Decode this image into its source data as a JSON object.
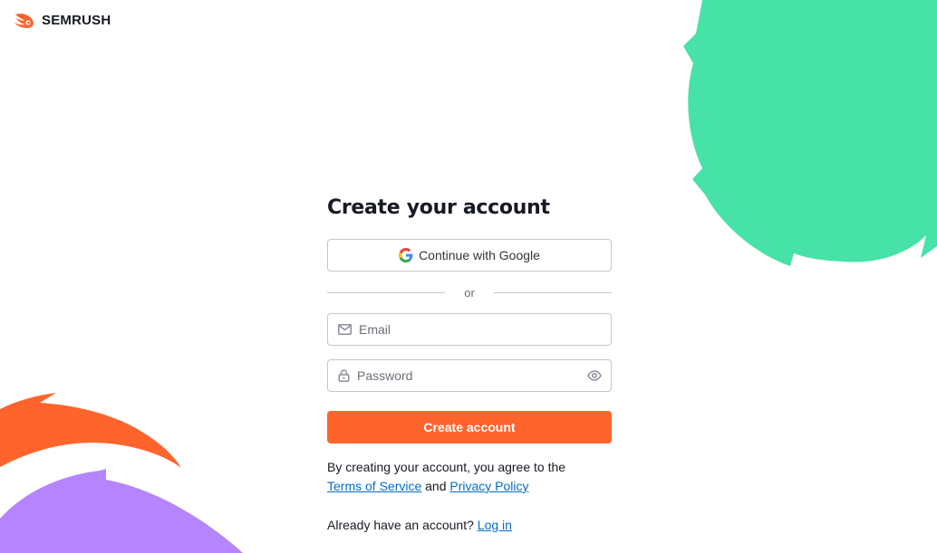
{
  "brand": {
    "name": "SEMRUSH",
    "accent_color": "#ff642d"
  },
  "page": {
    "title": "Create your account"
  },
  "google_button": {
    "label": "Continue with Google",
    "icon": "google-icon"
  },
  "divider": {
    "label": "or"
  },
  "email_field": {
    "placeholder": "Email",
    "value": "",
    "icon": "mail-icon"
  },
  "password_field": {
    "placeholder": "Password",
    "value": "",
    "icon": "lock-icon",
    "toggle_icon": "eye-icon"
  },
  "submit_button": {
    "label": "Create account"
  },
  "terms": {
    "prefix": "By creating your account, you agree to the",
    "terms_link": "Terms of Service",
    "conjunction": "and",
    "privacy_link": "Privacy Policy"
  },
  "login": {
    "prompt": "Already have an account?",
    "link": "Log in"
  },
  "decor_colors": {
    "green": "#47e2a8",
    "orange": "#ff642d",
    "purple": "#b585ff"
  }
}
